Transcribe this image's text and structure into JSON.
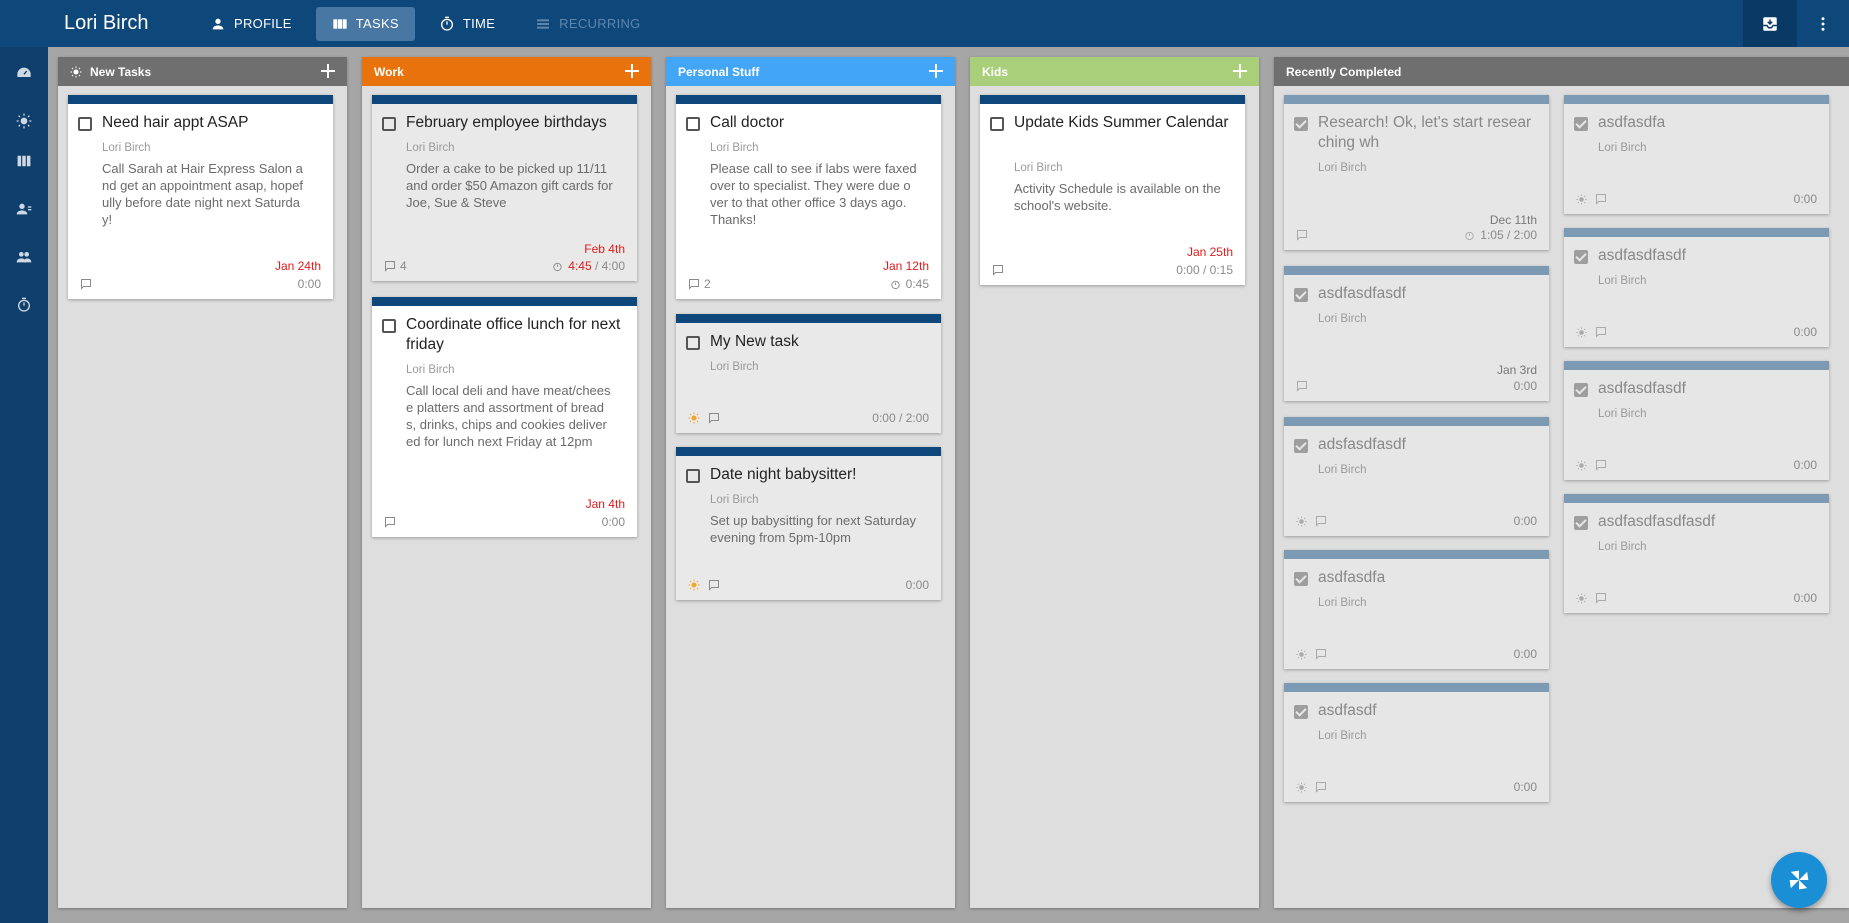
{
  "app": {
    "title": "Lori Birch"
  },
  "nav": [
    {
      "label": "PROFILE",
      "icon": "person-icon",
      "state": "normal"
    },
    {
      "label": "TASKS",
      "icon": "view-columns-icon",
      "state": "active"
    },
    {
      "label": "TIME",
      "icon": "timer-icon",
      "state": "normal"
    },
    {
      "label": "RECURRING",
      "icon": "list-icon",
      "state": "disabled"
    }
  ],
  "colors": {
    "topbar": "#0e477a",
    "rail": "#0e3f6d",
    "new_tasks": "#6f6f6f",
    "work": "#e8720c",
    "personal": "#42a5f5",
    "kids": "#a9cf7b",
    "recently_completed": "#6f6f6f",
    "card_stripe": "#0d477c",
    "done_stripe": "#7d9ab5",
    "due_red": "#e01b1b",
    "fab": "#1a8fd6"
  },
  "columns": {
    "new_tasks": {
      "name": "New Tasks",
      "cards": [
        {
          "title": "Need hair appt ASAP",
          "owner": "Lori Birch",
          "desc": "Call Sarah at Hair Express Salon and get an appointment asap, hopefully before date night next Saturday!",
          "due": "Jan 24th",
          "time": "0:00"
        }
      ]
    },
    "work": {
      "name": "Work",
      "cards": [
        {
          "title": "February employee birthdays",
          "owner": "Lori Birch",
          "desc": "Order a cake to be picked up 11/11 and order $50 Amazon gift cards for Joe, Sue & Steve",
          "due": "Feb 4th",
          "comments": "4",
          "time_spent": "4:45",
          "time_est": "/ 4:00"
        },
        {
          "title": "Coordinate office lunch for next friday",
          "owner": "Lori Birch",
          "desc": "Call local deli and have meat/cheese platters and assortment of breads, drinks, chips and cookies delivered for lunch next Friday at 12pm",
          "due": "Jan 4th",
          "time": "0:00"
        }
      ]
    },
    "personal": {
      "name": "Personal Stuff",
      "cards": [
        {
          "title": "Call doctor",
          "owner": "Lori Birch",
          "desc": "Please call to see if labs were faxed over to specialist. They were due over to that other office 3 days ago. Thanks!",
          "due": "Jan 12th",
          "comments": "2",
          "time": "0:45"
        },
        {
          "title": "My New task",
          "owner": "Lori Birch",
          "time": "0:00 / 2:00"
        },
        {
          "title": "Date night babysitter!",
          "owner": "Lori Birch",
          "desc": "Set up babysitting for next Saturday evening from 5pm-10pm",
          "time": "0:00"
        }
      ]
    },
    "kids": {
      "name": "Kids",
      "cards": [
        {
          "title": "Update Kids Summer Calendar",
          "owner": "Lori Birch",
          "desc": "Activity Schedule is available on the school's website.",
          "due": "Jan 25th",
          "time": "0:00 / 0:15"
        }
      ]
    },
    "completed": {
      "name": "Recently Completed",
      "left": [
        {
          "title": "Research! Ok, let's start researching wh",
          "owner": "Lori Birch",
          "due": "Dec 11th",
          "time": "1:05 / 2:00"
        },
        {
          "title": "asdfasdfasdf",
          "owner": "Lori Birch",
          "due": "Jan 3rd",
          "time": "0:00"
        },
        {
          "title": "adsfasdfasdf",
          "owner": "Lori Birch",
          "time": "0:00"
        },
        {
          "title": "asdfasdfa",
          "owner": "Lori Birch",
          "time": "0:00"
        },
        {
          "title": "asdfasdf",
          "owner": "Lori Birch",
          "time": "0:00"
        }
      ],
      "right": [
        {
          "title": "asdfasdfa",
          "owner": "Lori Birch",
          "time": "0:00"
        },
        {
          "title": "asdfasdfasdf",
          "owner": "Lori Birch",
          "time": "0:00"
        },
        {
          "title": "asdfasdfasdf",
          "owner": "Lori Birch",
          "time": "0:00"
        },
        {
          "title": "asdfasdfasdfasdf",
          "owner": "Lori Birch",
          "time": "0:00"
        }
      ]
    }
  }
}
